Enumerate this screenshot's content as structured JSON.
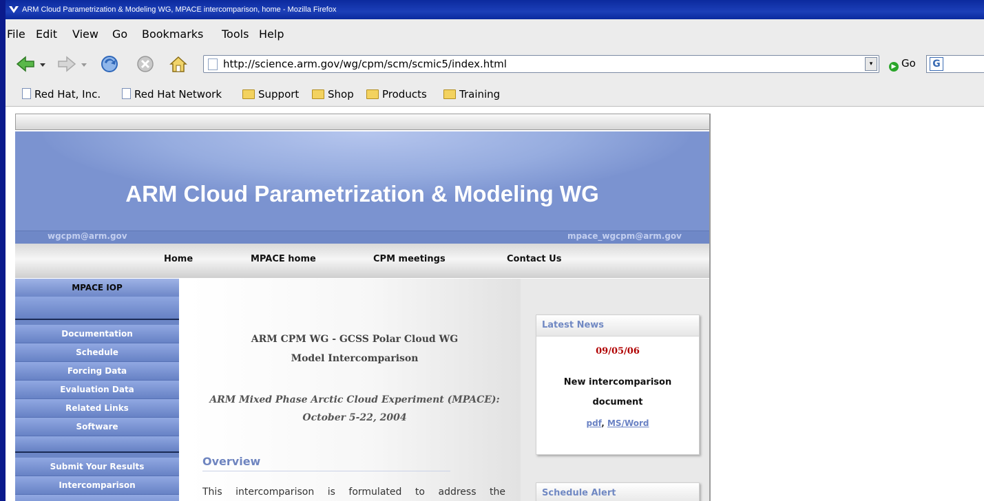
{
  "window": {
    "title": "ARM Cloud Parametrization & Modeling WG, MPACE intercomparison, home - Mozilla Firefox"
  },
  "menu": [
    "File",
    "Edit",
    "View",
    "Go",
    "Bookmarks",
    "Tools",
    "Help"
  ],
  "toolbar": {
    "url": "http://science.arm.gov/wg/cpm/scm/scmic5/index.html",
    "go_label": "Go"
  },
  "bookmarks": [
    {
      "label": "Red Hat, Inc.",
      "icon": "page-icon"
    },
    {
      "label": "Red Hat Network",
      "icon": "page-icon"
    },
    {
      "label": "Support",
      "icon": "folder-icon"
    },
    {
      "label": "Shop",
      "icon": "folder-icon"
    },
    {
      "label": "Products",
      "icon": "folder-icon"
    },
    {
      "label": "Training",
      "icon": "folder-icon"
    }
  ],
  "banner": {
    "title": "ARM Cloud Parametrization & Modeling WG",
    "email_left": "wgcpm@arm.gov",
    "email_right": "mpace_wgcpm@arm.gov"
  },
  "nav": [
    "Home",
    "MPACE home",
    "CPM meetings",
    "Contact Us"
  ],
  "sidebar": {
    "header": "MPACE IOP",
    "items": [
      "Documentation",
      "Schedule",
      "Forcing Data",
      "Evaluation Data",
      "Related Links",
      "Software",
      "Submit Your Results",
      "Intercomparison"
    ]
  },
  "main": {
    "title1": "ARM CPM WG - GCSS Polar Cloud WG",
    "title2": "Model Intercomparison",
    "italic1": "ARM Mixed Phase Arctic Cloud Experiment (MPACE):",
    "italic2": "October 5-22, 2004",
    "overview_heading": "Overview",
    "overview_text": "This intercomparison is formulated to address the"
  },
  "news": {
    "heading": "Latest News",
    "date": "09/05/06",
    "line1": "New intercomparison",
    "line2": "document",
    "link1": "pdf",
    "link_sep": ",",
    "link2": "MS/Word"
  },
  "schedule_alert": {
    "heading": "Schedule Alert"
  }
}
